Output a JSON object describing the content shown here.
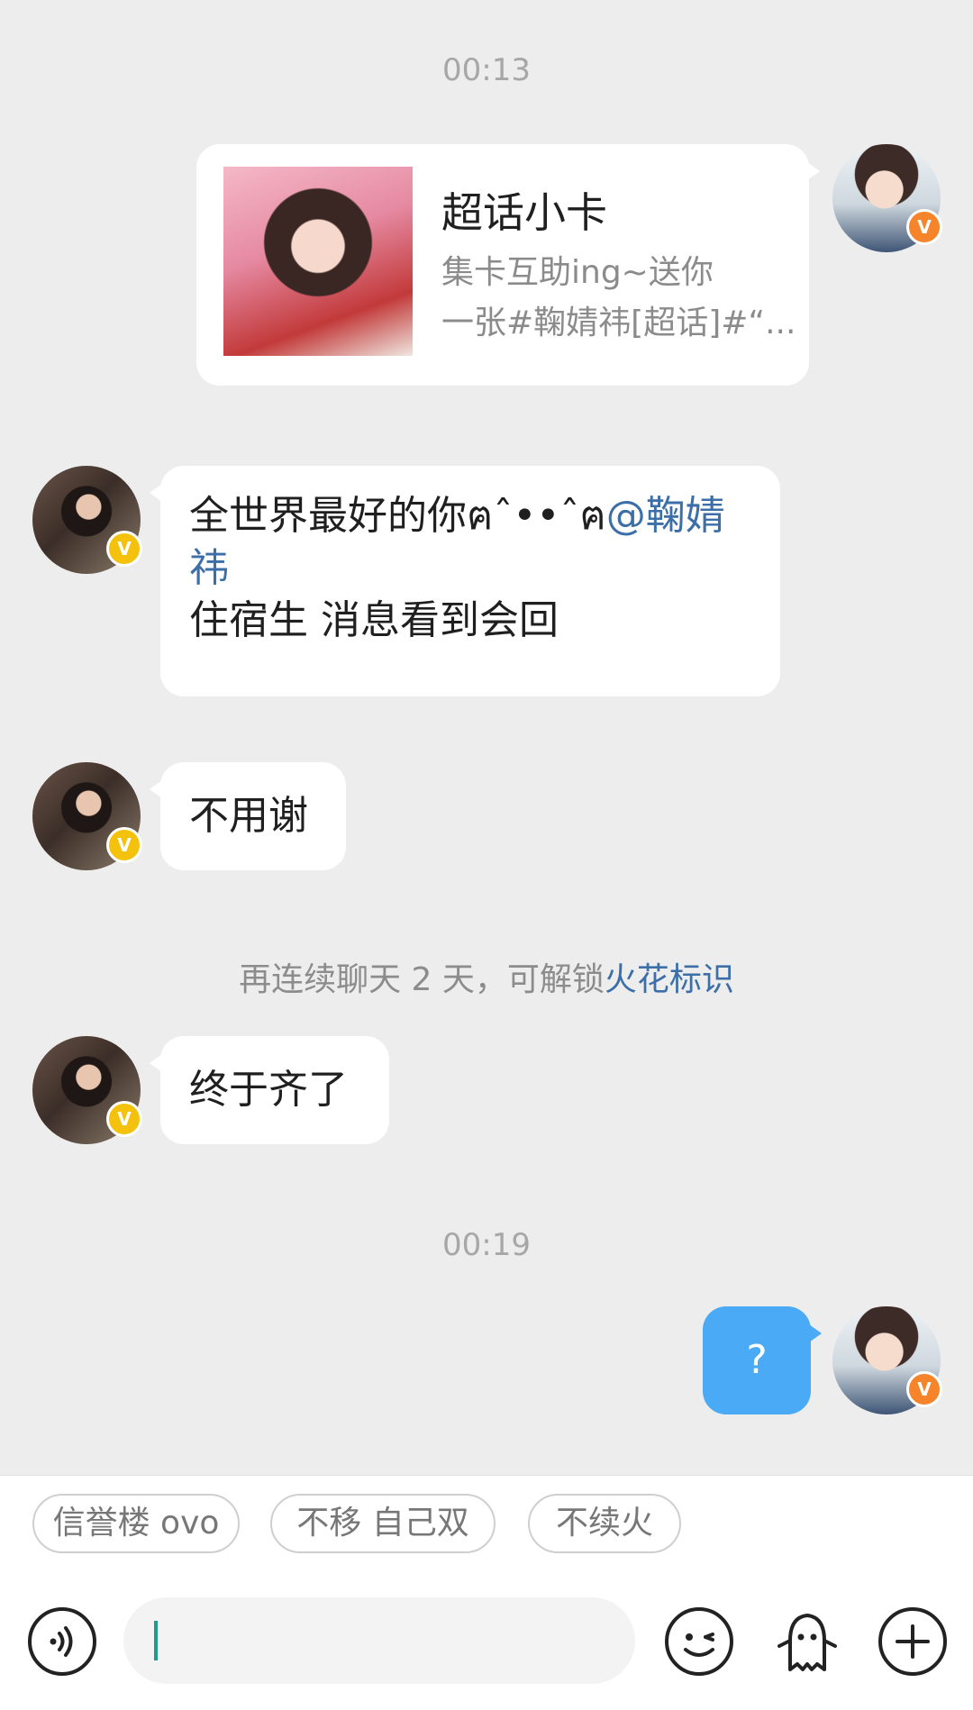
{
  "chat": {
    "timestamps": [
      "00:13",
      "00:19"
    ],
    "card": {
      "title": "超话小卡",
      "desc_line1": "集卡互助ing~送你",
      "desc_line2": "一张#鞠婧祎[超话]#“..."
    },
    "messages": [
      {
        "line1_text": "全世界最好的你ฅˆ••ˆฅ",
        "line1_mention": "@鞠婧",
        "line2_mention": "祎",
        "line3": "住宿生 消息看到会回"
      },
      {
        "text": "不用谢"
      },
      {
        "text": "终于齐了"
      },
      {
        "text": "?"
      }
    ],
    "system_note": {
      "text": "再连续聊天 2 天，可解锁",
      "link": "火花标识"
    },
    "badge_letter": "V"
  },
  "quick_replies": [
    "信誉楼 ovo",
    "不移 自己双",
    "不续火"
  ],
  "input": {
    "value": ""
  },
  "colors": {
    "background": "#ededed",
    "bubble_self": "#4aaaf5",
    "mention": "#3c6ea8",
    "badge_orange": "#f5842a",
    "badge_yellow": "#f4c20d"
  },
  "icons": [
    "voice-icon",
    "emoji-icon",
    "pet-icon",
    "plus-icon"
  ]
}
